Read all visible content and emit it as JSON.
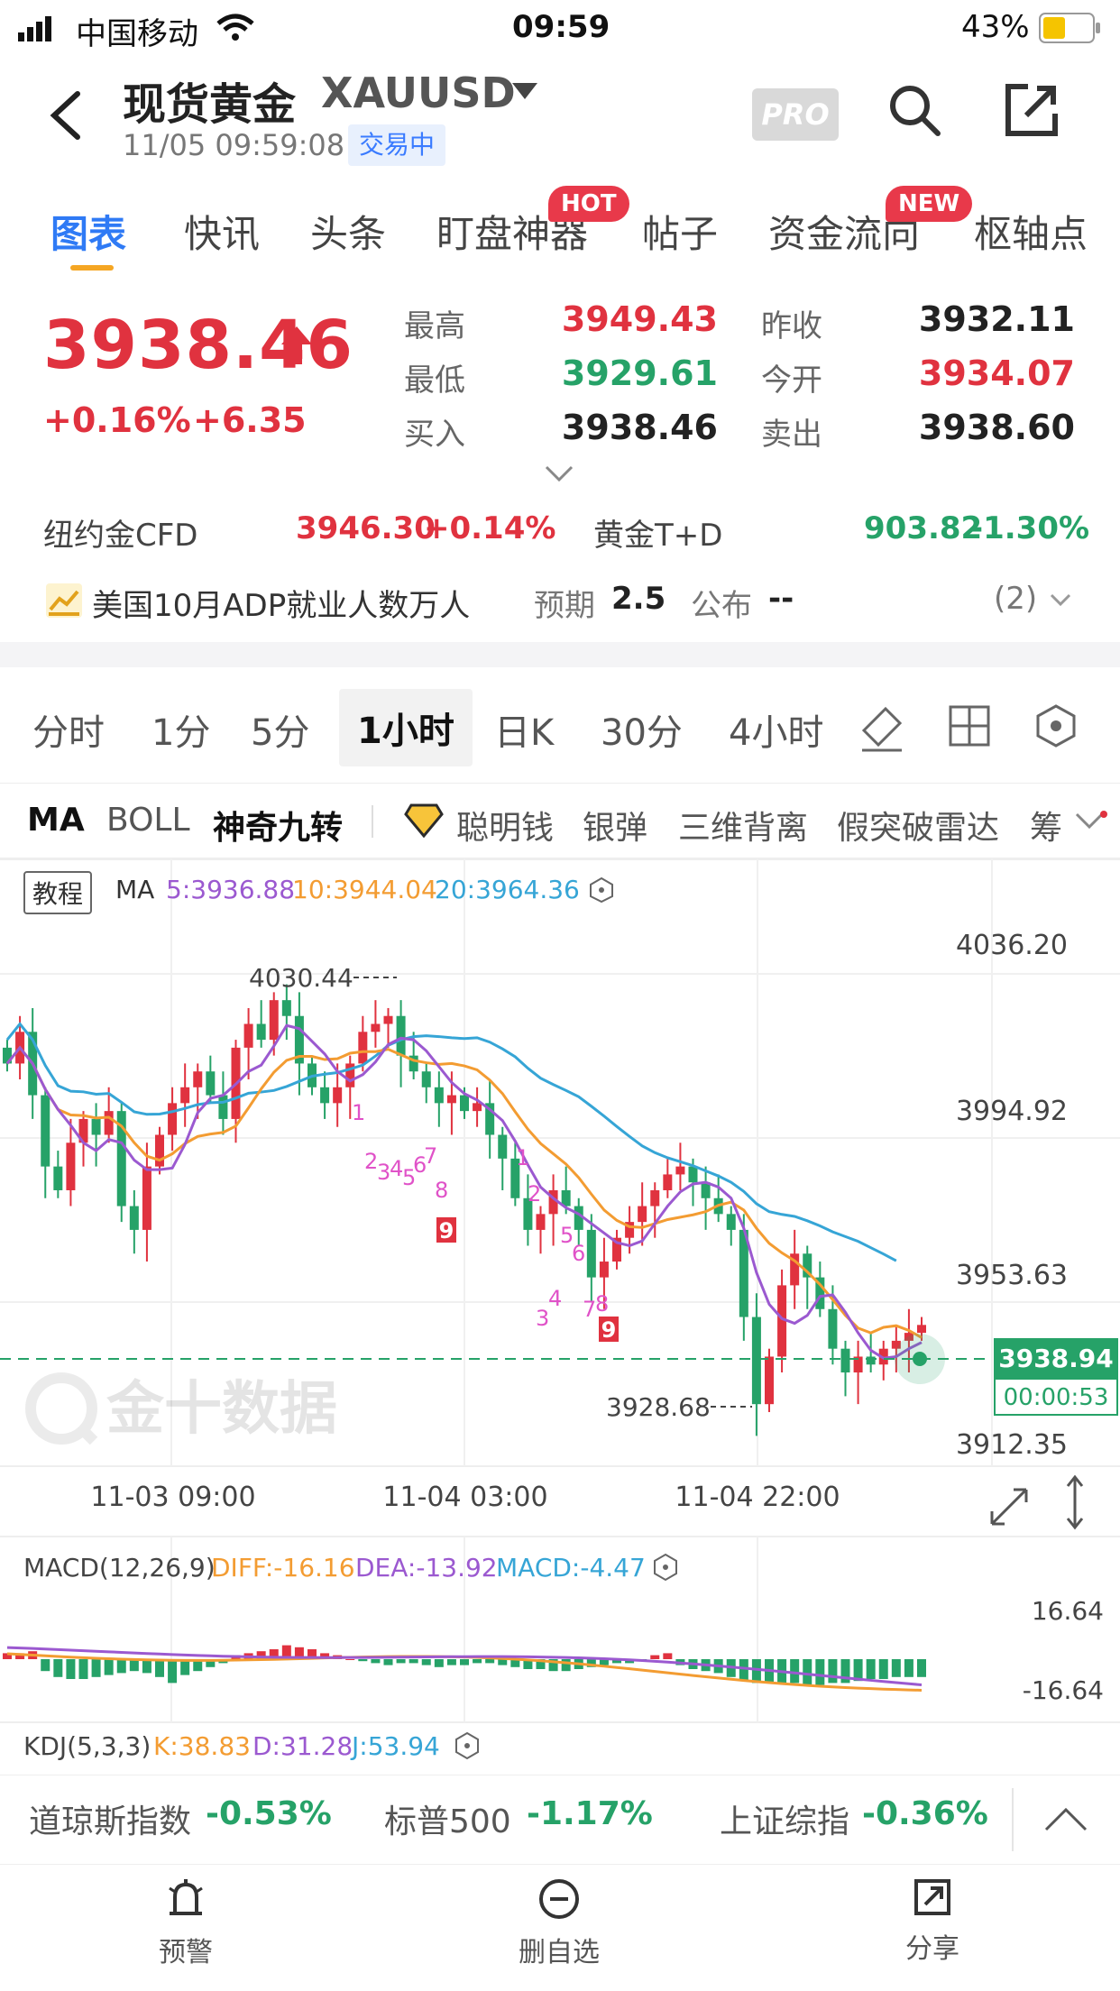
{
  "status_bar": {
    "carrier": "中国移动",
    "time": "09:59",
    "battery": "43%"
  },
  "header": {
    "title": "现货黄金",
    "symbol": "XAUUSD",
    "datetime": "11/05 09:59:08",
    "trade_status": "交易中",
    "pro_label": "PRO"
  },
  "tabs": [
    {
      "label": "图表",
      "active": true
    },
    {
      "label": "快讯"
    },
    {
      "label": "头条"
    },
    {
      "label": "盯盘神器",
      "badge": "HOT"
    },
    {
      "label": "帖子"
    },
    {
      "label": "资金流向",
      "badge": "NEW"
    },
    {
      "label": "枢轴点"
    }
  ],
  "quote": {
    "price": "3938.46",
    "change_pct": "+0.16%",
    "change_abs": "+6.35",
    "high_label": "最高",
    "high": "3949.43",
    "low_label": "最低",
    "low": "3929.61",
    "bid_label": "买入",
    "bid": "3938.46",
    "prev_close_label": "昨收",
    "prev_close": "3932.11",
    "open_label": "今开",
    "open": "3934.07",
    "ask_label": "卖出",
    "ask": "3938.60"
  },
  "related": [
    {
      "name": "纽约金CFD",
      "value": "3946.30",
      "change": "+0.14%",
      "color": "#e0323f"
    },
    {
      "name": "黄金T+D",
      "value": "903.82",
      "change": "-1.30%",
      "color": "#26a268"
    }
  ],
  "event": {
    "title": "美国10月ADP就业人数万人",
    "expect_label": "预期",
    "expect": "2.5",
    "publish_label": "公布",
    "publish": "--",
    "count": "(2)"
  },
  "intervals": [
    {
      "label": "分时"
    },
    {
      "label": "1分"
    },
    {
      "label": "5分"
    },
    {
      "label": "1小时",
      "active": true
    },
    {
      "label": "日K"
    },
    {
      "label": "30分"
    },
    {
      "label": "4小时"
    }
  ],
  "indicators": [
    {
      "label": "MA",
      "bold": true
    },
    {
      "label": "BOLL"
    },
    {
      "label": "神奇九转",
      "bold": true
    },
    {
      "label": "聪明钱"
    },
    {
      "label": "银弹"
    },
    {
      "label": "三维背离"
    },
    {
      "label": "假突破雷达"
    },
    {
      "label": "筹"
    }
  ],
  "chart": {
    "tutorial_label": "教程",
    "ma_label": "MA",
    "ma5": "5:3936.88",
    "ma10": "10:3944.04",
    "ma20": "20:3964.36",
    "watermark": "金十数据",
    "high_annotation": "4030.44",
    "low_annotation": "3928.68",
    "y_ticks": [
      "4036.20",
      "3994.92",
      "3953.63",
      "3912.35"
    ],
    "x_ticks": [
      "11-03 09:00",
      "11-04 03:00",
      "11-04 22:00"
    ],
    "current_price": "3938.94",
    "countdown": "00:00:53",
    "colors": {
      "up": "#e0323f",
      "down": "#26a268",
      "ma5": "#9b59d0",
      "ma10": "#f39c32",
      "ma20": "#36a5d6",
      "nine": "#e052c8"
    },
    "macd_label": "MACD(12,26,9)",
    "diff": "DIFF:-16.16",
    "dea": "DEA:-13.92",
    "macd": "MACD:-4.47",
    "macd_ticks": [
      "16.64",
      "-16.64"
    ],
    "kdj_label": "KDJ(5,3,3)",
    "kdj_k": "K:38.83",
    "kdj_d": "D:31.28",
    "kdj_j": "J:53.94"
  },
  "chart_data": {
    "type": "candlestick",
    "ylim": [
      3912.35,
      4036.2
    ],
    "x_labels": [
      "11-03 09:00",
      "11-04 03:00",
      "11-04 22:00"
    ],
    "high_annotation": 4030.44,
    "low_annotation": 3928.68,
    "current": 3938.94
  },
  "index_bar": [
    {
      "name": "道琼斯指数",
      "value": "-0.53%"
    },
    {
      "name": "标普500",
      "value": "-1.17%"
    },
    {
      "name": "上证综指",
      "value": "-0.36%"
    }
  ],
  "nav": [
    {
      "label": "预警",
      "icon": "alarm-icon"
    },
    {
      "label": "删自选",
      "icon": "minus-circle-icon"
    },
    {
      "label": "分享",
      "icon": "share-icon"
    }
  ]
}
